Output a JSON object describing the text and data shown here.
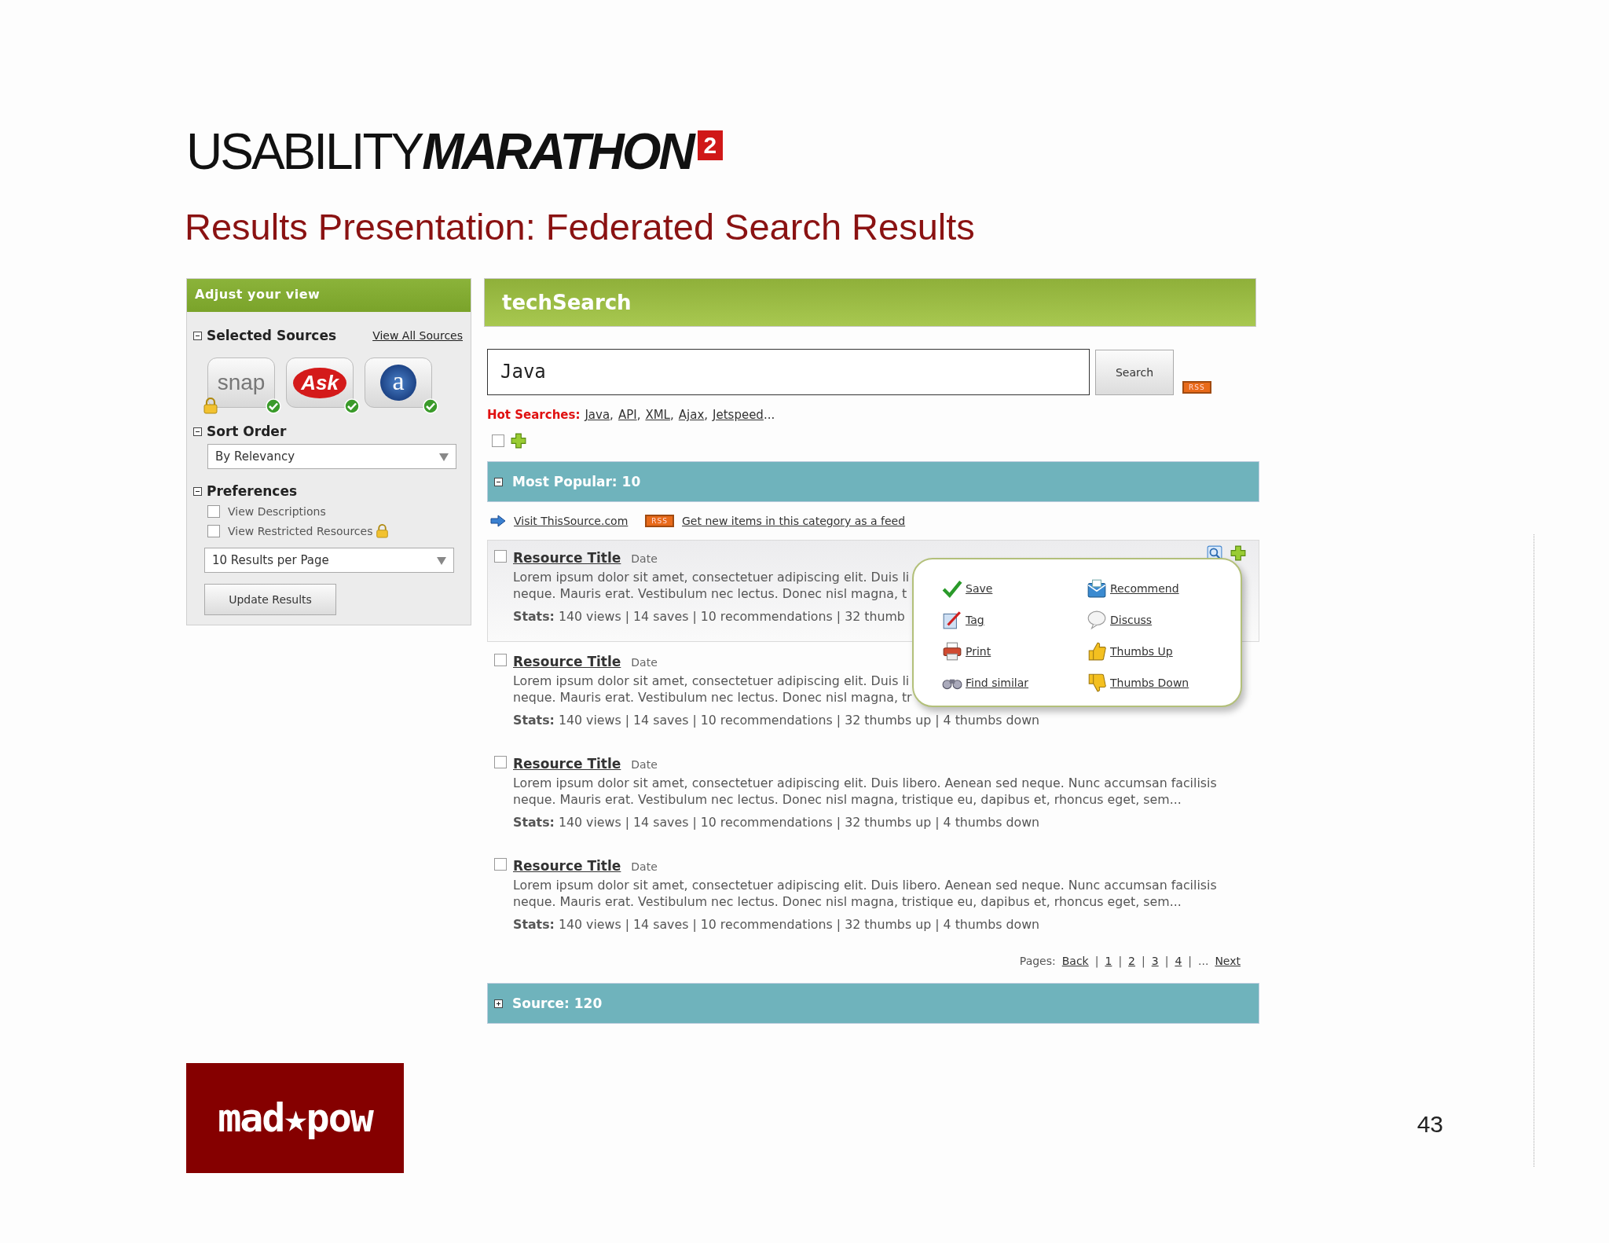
{
  "slide": {
    "logo_light": "USABILITY",
    "logo_bold": "MARATHON",
    "logo_badge": "2",
    "title": "Results Presentation: Federated Search Results",
    "footer_logo": "mad★pow",
    "page_number": "43"
  },
  "sidebar": {
    "title": "Adjust your view",
    "sources_section": {
      "heading": "Selected Sources",
      "expanded": true,
      "link": "View All Sources",
      "sources": [
        {
          "label": "snap",
          "kind": "text_logo",
          "selected": true,
          "locked": true
        },
        {
          "label": "Ask",
          "kind": "oval_logo",
          "selected": true,
          "locked": false
        },
        {
          "label": "a",
          "kind": "circle_logo",
          "selected": true,
          "locked": false
        }
      ]
    },
    "sort_section": {
      "heading": "Sort Order",
      "expanded": true,
      "dropdown": "By Relevancy"
    },
    "preferences_section": {
      "heading": "Preferences",
      "expanded": true,
      "options": [
        {
          "label": "View Descriptions",
          "checked": false,
          "locked": false
        },
        {
          "label": "View Restricted Resources",
          "checked": false,
          "locked": true
        }
      ],
      "dropdown": "10 Results per Page",
      "button": "Update Results"
    }
  },
  "app": {
    "title": "techSearch",
    "search": {
      "value": "Java",
      "button": "Search",
      "rss": "RSS"
    },
    "hot_searches": {
      "label": "Hot Searches:",
      "items": [
        "Java",
        "API",
        "XML",
        "Ajax",
        "Jetspeed"
      ],
      "separator": ",",
      "suffix": "..."
    },
    "select_all": {
      "checked": false
    },
    "groups": [
      {
        "title": "Most Popular: 10",
        "expanded": true,
        "visit_link": "Visit ThisSource.com",
        "feed_badge": "RSS",
        "feed_link": "Get new items in this category as a feed",
        "results": [
          {
            "title": "Resource Title",
            "date": "Date",
            "checked": false,
            "hovered": true,
            "lines": [
              "Lorem ipsum dolor sit amet, consectetuer adipiscing elit. Duis li",
              "neque. Mauris erat. Vestibulum nec lectus. Donec nisl magna, t"
            ],
            "stats": "**Stats:** 140 views | 14 saves | 10 recommendations | 32 thumb",
            "menu": [
              {
                "label": "Save",
                "kind": "save"
              },
              {
                "label": "Recommend",
                "kind": "recommend"
              },
              {
                "label": "Tag",
                "kind": "tag"
              },
              {
                "label": "Discuss",
                "kind": "discuss"
              },
              {
                "label": "Print",
                "kind": "print"
              },
              {
                "label": "Thumbs Up",
                "kind": "thumbs_up"
              },
              {
                "label": "Find similar",
                "kind": "find_similar"
              },
              {
                "label": "Thumbs Down",
                "kind": "thumbs_down"
              }
            ]
          },
          {
            "title": "Resource Title",
            "date": "Date",
            "checked": false,
            "hovered": false,
            "lines": [
              "Lorem ipsum dolor sit amet, consectetuer adipiscing elit. Duis li",
              "neque. Mauris erat. Vestibulum nec lectus. Donec nisl magna, tr"
            ],
            "stats": "**Stats:** 140 views | 14 saves | 10 recommendations | 32 thumbs up | 4 thumbs down"
          },
          {
            "title": "Resource Title",
            "date": "Date",
            "checked": false,
            "hovered": false,
            "lines": [
              "Lorem ipsum dolor sit amet, consectetuer adipiscing elit. Duis libero. Aenean sed neque. Nunc accumsan facilisis",
              "neque. Mauris erat. Vestibulum nec lectus. Donec nisl magna, tristique eu, dapibus et, rhoncus eget, sem..."
            ],
            "stats": "**Stats:** 140 views | 14 saves | 10 recommendations | 32 thumbs up | 4 thumbs down"
          },
          {
            "title": "Resource Title",
            "date": "Date",
            "checked": false,
            "hovered": false,
            "lines": [
              "Lorem ipsum dolor sit amet, consectetuer adipiscing elit. Duis libero. Aenean sed neque. Nunc accumsan facilisis",
              "neque. Mauris erat. Vestibulum nec lectus. Donec nisl magna, tristique eu, dapibus et, rhoncus eget, sem..."
            ],
            "stats": "**Stats:** 140 views | 14 saves | 10 recommendations | 32 thumbs up | 4 thumbs down"
          }
        ],
        "pagination": {
          "label": "Pages:",
          "items": [
            "Back",
            "1",
            "2",
            "3",
            "4"
          ],
          "separator": "|",
          "ellipsis": "...",
          "next": "Next"
        }
      },
      {
        "title": "Source: 120",
        "expanded": false
      }
    ]
  }
}
